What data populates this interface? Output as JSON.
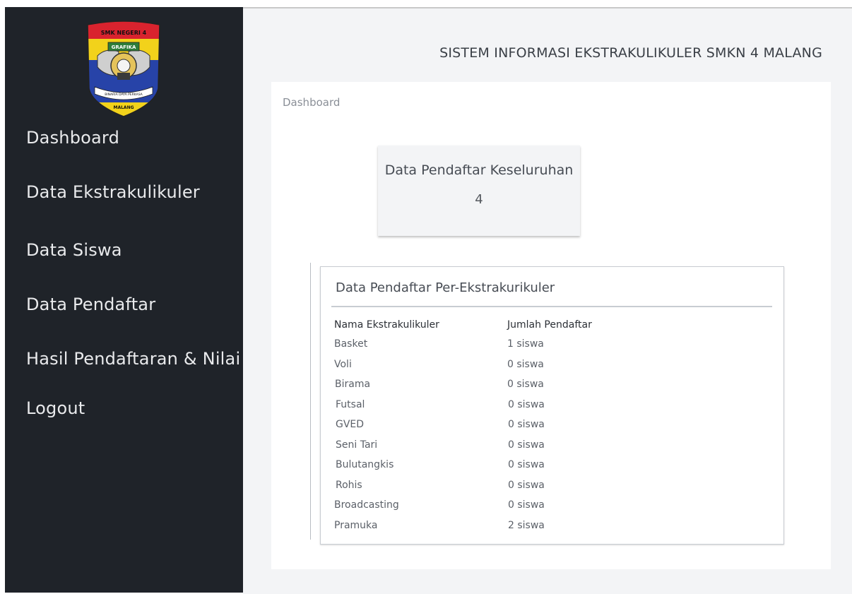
{
  "logo": {
    "top_text": "SMK NEGERI 4",
    "band_text": "GRAFIKA",
    "ribbon_text": "BINARIA DAYA PERKASA",
    "bottom_text": "MALANG"
  },
  "sidebar": {
    "items": [
      {
        "label": "Dashboard"
      },
      {
        "label": "Data Ekstrakulikuler"
      },
      {
        "label": "Data Siswa"
      },
      {
        "label": "Data Pendaftar"
      },
      {
        "label": "Hasil Pendaftaran & Nilai"
      },
      {
        "label": "Logout"
      }
    ]
  },
  "header": {
    "title": "SISTEM INFORMASI EKSTRAKULIKULER SMKN 4 MALANG"
  },
  "breadcrumb": "Dashboard",
  "summary_card": {
    "title": "Data Pendaftar Keseluruhan",
    "value": "4"
  },
  "registrants_table": {
    "title": "Data Pendaftar Per-Ekstrakurikuler",
    "columns": [
      "Nama Ekstrakulikuler",
      "Jumlah Pendaftar"
    ],
    "rows": [
      {
        "name": "Basket",
        "count": "1 siswa"
      },
      {
        "name": "Voli",
        "count": "0 siswa"
      },
      {
        "name": "Birama",
        "count": "0 siswa"
      },
      {
        "name": "Futsal",
        "count": "0 siswa"
      },
      {
        "name": "GVED",
        "count": "0 siswa"
      },
      {
        "name": "Seni Tari",
        "count": "0 siswa"
      },
      {
        "name": "Bulutangkis",
        "count": "0 siswa"
      },
      {
        "name": "Rohis",
        "count": "0 siswa"
      },
      {
        "name": "Broadcasting",
        "count": "0 siswa"
      },
      {
        "name": "Pramuka",
        "count": "2 siswa"
      }
    ]
  },
  "colors": {
    "sidebar_bg": "#1f2329",
    "main_bg": "#f3f4f6",
    "logo_red": "#d9232e",
    "logo_yellow": "#f2d21b",
    "logo_blue": "#2743a8"
  }
}
